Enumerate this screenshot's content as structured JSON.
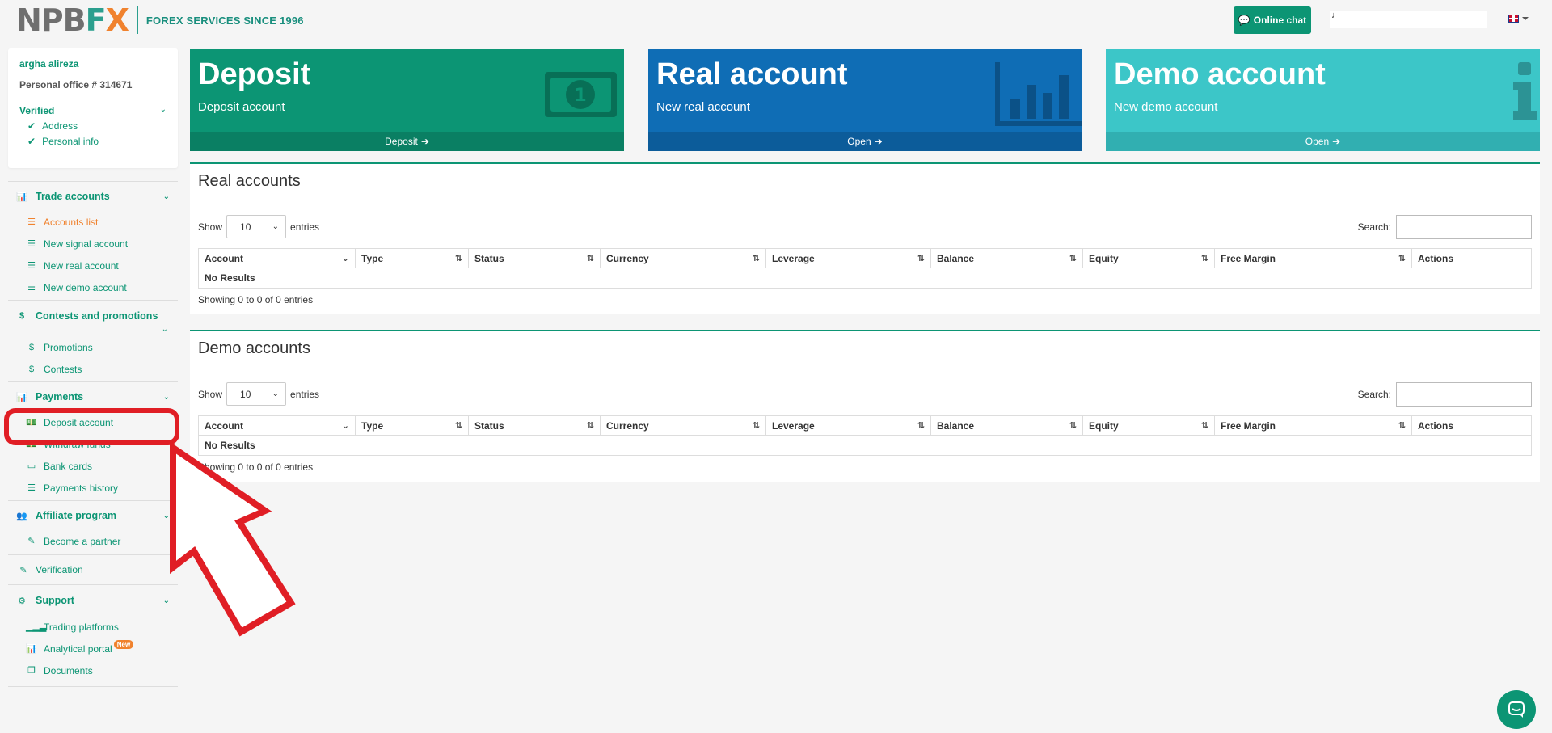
{
  "header": {
    "logo_npb": "NPB",
    "logo_f": "F",
    "logo_x": "X",
    "tagline": "FOREX SERVICES SINCE 1996",
    "online_chat": "Online chat",
    "user_text": "♩"
  },
  "profile": {
    "name": "argha alireza",
    "office": "Personal office # 314671",
    "verified": "Verified",
    "checks": [
      "Address",
      "Personal info"
    ]
  },
  "sidebar": {
    "trade": {
      "title": "Trade accounts",
      "items": [
        "Accounts list",
        "New signal account",
        "New real account",
        "New demo account"
      ]
    },
    "contests": {
      "title": "Contests and promotions",
      "items": [
        "Promotions",
        "Contests"
      ]
    },
    "payments": {
      "title": "Payments",
      "items": [
        "Deposit account",
        "Withdraw funds",
        "Bank cards",
        "Payments history"
      ]
    },
    "affiliate": {
      "title": "Affiliate program",
      "items": [
        "Become a partner"
      ]
    },
    "verification": "Verification",
    "support": {
      "title": "Support",
      "items": [
        "Trading platforms",
        "Analytical portal",
        "Documents"
      ],
      "new_badge": "New"
    }
  },
  "cards": {
    "deposit": {
      "title": "Deposit",
      "subtitle": "Deposit account",
      "footer": "Deposit"
    },
    "real": {
      "title": "Real account",
      "subtitle": "New real account",
      "footer": "Open"
    },
    "demo": {
      "title": "Demo account",
      "subtitle": "New demo account",
      "footer": "Open"
    }
  },
  "real_accounts": {
    "title": "Real accounts",
    "show": "Show",
    "entries": "entries",
    "page_size": "10",
    "search_label": "Search:",
    "columns": [
      "Account",
      "Type",
      "Status",
      "Currency",
      "Leverage",
      "Balance",
      "Equity",
      "Free Margin",
      "Actions"
    ],
    "empty": "No Results",
    "info": "Showing 0 to 0 of 0 entries"
  },
  "demo_accounts": {
    "title": "Demo accounts",
    "show": "Show",
    "entries": "entries",
    "page_size": "10",
    "search_label": "Search:",
    "columns": [
      "Account",
      "Type",
      "Status",
      "Currency",
      "Leverage",
      "Balance",
      "Equity",
      "Free Margin",
      "Actions"
    ],
    "empty": "No Results",
    "info": "Showing 0 to 0 of 0 entries"
  },
  "colors": {
    "brand_green": "#0c9574",
    "brand_orange": "#f0822e",
    "real_blue": "#0f6db5",
    "demo_teal": "#3cc6c8",
    "highlight_red": "#e01e25"
  }
}
